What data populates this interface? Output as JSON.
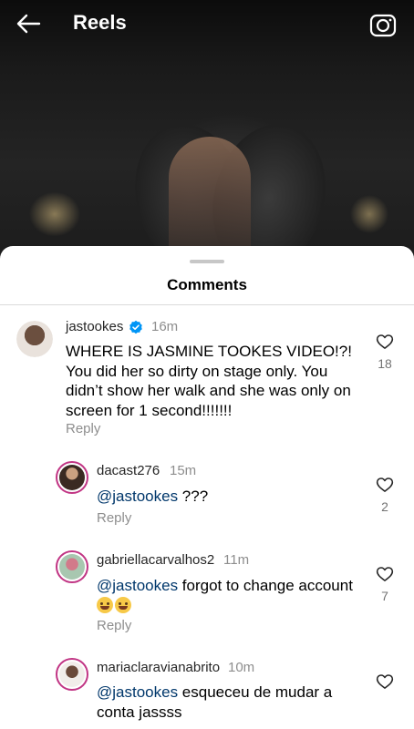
{
  "header": {
    "title": "Reels",
    "back_icon": "arrow-left-icon",
    "camera_icon": "camera-icon"
  },
  "sheet": {
    "title": "Comments"
  },
  "comments": [
    {
      "username": "jastookes",
      "verified": true,
      "time": "16m",
      "text": "WHERE IS JASMINE TOOKES VIDEO!?! You did her so dirty on stage only. You didn’t show her walk and she was only on screen for 1 second!!!!!!!",
      "reply_label": "Reply",
      "likes": "18"
    }
  ],
  "replies": [
    {
      "username": "dacast276",
      "time": "15m",
      "mention": "@jastookes",
      "text": " ???",
      "reply_label": "Reply",
      "likes": "2"
    },
    {
      "username": "gabriellacarvalhos2",
      "time": "11m",
      "mention": "@jastookes",
      "text": " forgot to change account",
      "emoji": "😂😅",
      "reply_label": "Reply",
      "likes": "7"
    },
    {
      "username": "mariaclaravianabrito",
      "time": "10m",
      "mention": "@jastookes",
      "text": " esqueceu de mudar a conta jassss"
    }
  ],
  "colors": {
    "mention": "#00376b",
    "secondary_text": "#8e8e8e",
    "story_ring": "#c13584",
    "verified_badge": "#0095f6"
  }
}
